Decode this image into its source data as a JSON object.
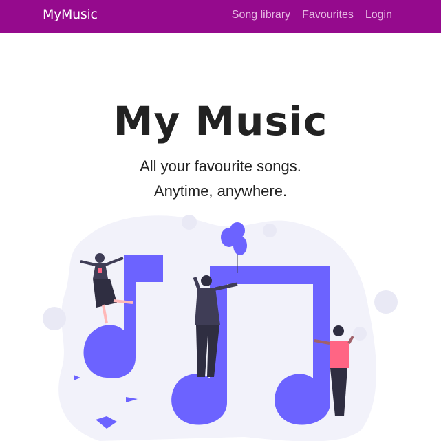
{
  "navbar": {
    "brand": "MyMusic",
    "links": [
      "Song library",
      "Favourites",
      "Login"
    ],
    "background_color": "#950a8d"
  },
  "hero": {
    "title": "My Music",
    "tagline_line1": "All your favourite songs.",
    "tagline_line2": "Anytime, anywhere."
  },
  "illustration": {
    "name": "music-notes-people-illustration",
    "accent_color": "#6c63ff",
    "blob_color": "#f2f2fa"
  }
}
